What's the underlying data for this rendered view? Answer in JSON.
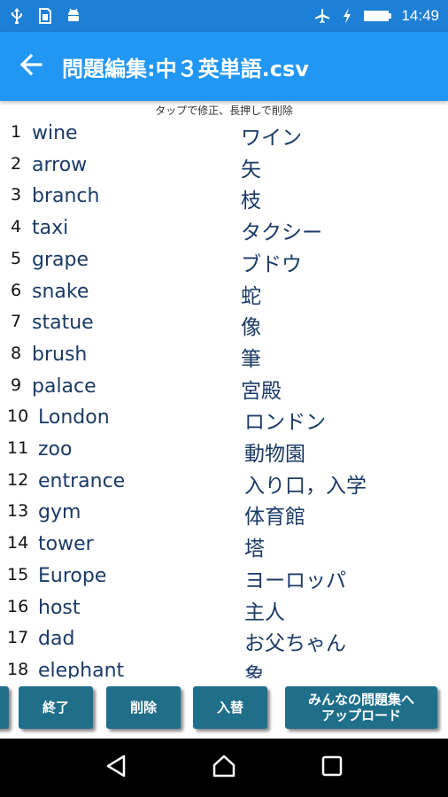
{
  "status_bar": {
    "time": "14:49",
    "left_icons": [
      "usb-icon",
      "sim-icon",
      "android-icon"
    ],
    "right_icons": [
      "airplane-icon",
      "charging-icon",
      "battery-icon"
    ]
  },
  "app_bar": {
    "title": "問題編集:中３英単語.csv",
    "back_icon": "arrow-left-icon"
  },
  "hint": "タップで修正、長押しで削除",
  "rows": [
    {
      "num": "1",
      "en": "wine",
      "ja": "ワイン"
    },
    {
      "num": "2",
      "en": "arrow",
      "ja": "矢"
    },
    {
      "num": "3",
      "en": "branch",
      "ja": "枝"
    },
    {
      "num": "4",
      "en": "taxi",
      "ja": "タクシー"
    },
    {
      "num": "5",
      "en": "grape",
      "ja": "ブドウ"
    },
    {
      "num": "6",
      "en": "snake",
      "ja": "蛇"
    },
    {
      "num": "7",
      "en": "statue",
      "ja": "像"
    },
    {
      "num": "8",
      "en": "brush",
      "ja": "筆"
    },
    {
      "num": "9",
      "en": "palace",
      "ja": "宮殿"
    },
    {
      "num": "10",
      "en": "London",
      "ja": "ロンドン"
    },
    {
      "num": "11",
      "en": "zoo",
      "ja": "動物園"
    },
    {
      "num": "12",
      "en": "entrance",
      "ja": "入り口，入学"
    },
    {
      "num": "13",
      "en": "gym",
      "ja": "体育館"
    },
    {
      "num": "14",
      "en": "tower",
      "ja": "塔"
    },
    {
      "num": "15",
      "en": "Europe",
      "ja": "ヨーロッパ"
    },
    {
      "num": "16",
      "en": "host",
      "ja": "主人"
    },
    {
      "num": "17",
      "en": "dad",
      "ja": "お父ちゃん"
    },
    {
      "num": "18",
      "en": "elephant",
      "ja": "象"
    }
  ],
  "toolbar": {
    "end_label": "終了",
    "delete_label": "削除",
    "swap_label": "入替",
    "upload_label_line1": "みんなの問題集へ",
    "upload_label_line2": "アップロード"
  },
  "nav_bar": {
    "icons": [
      "back-triangle-icon",
      "home-circle-icon",
      "recents-square-icon"
    ]
  },
  "colors": {
    "status_bar": "#1e7fd6",
    "app_bar": "#2196f3",
    "button": "#1f6f8b",
    "text_navy": "#1a3a66"
  }
}
